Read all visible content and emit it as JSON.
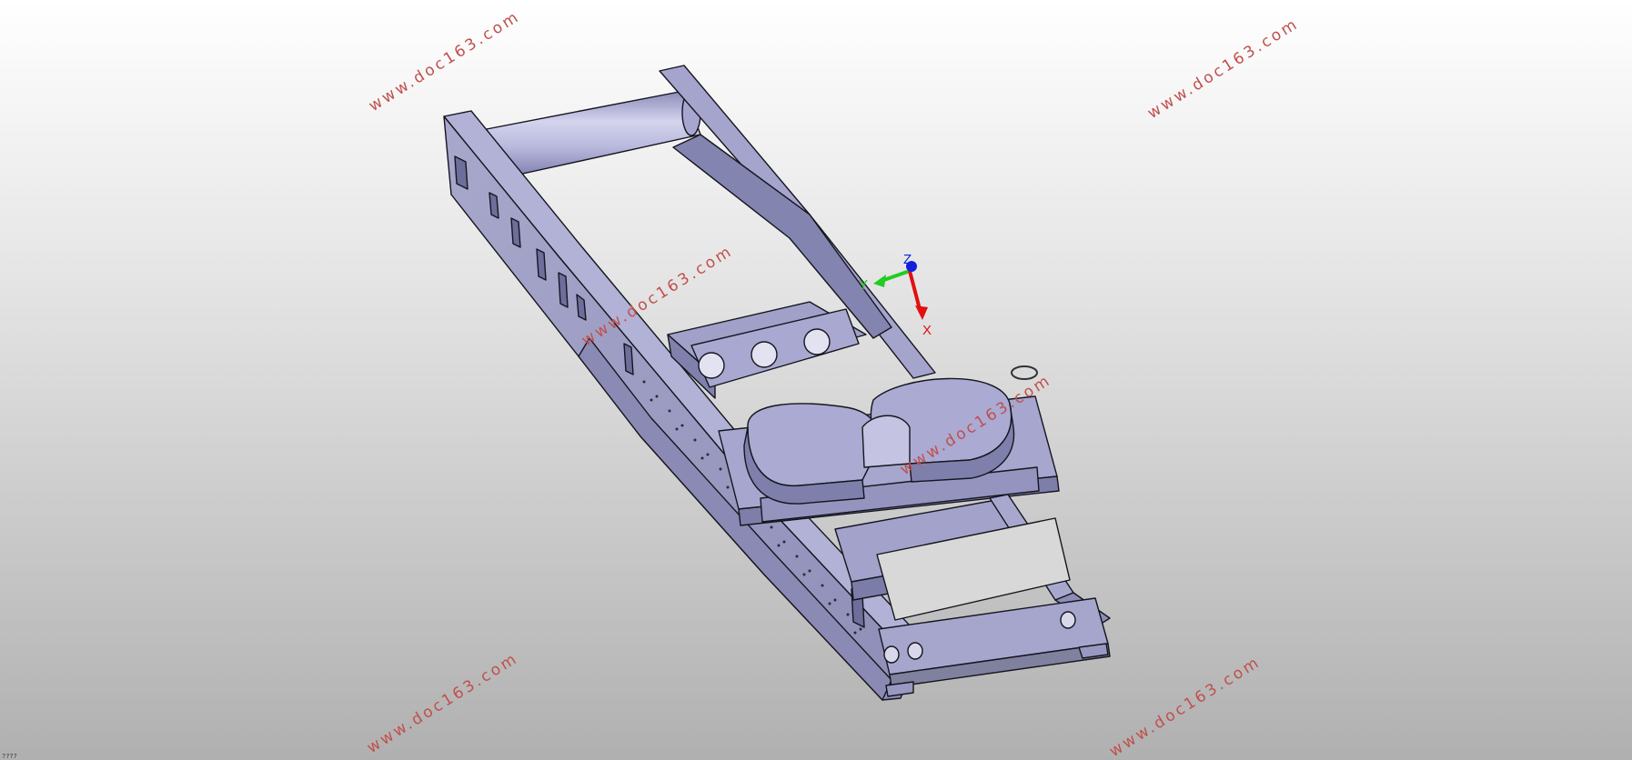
{
  "viewport": {
    "background_top": "#ffffff",
    "background_bottom": "#b0b0b0",
    "model_color": "#9c9cc4",
    "model_edge_color": "#15151f"
  },
  "triad": {
    "x_label": "X",
    "y_label": "Y",
    "z_label": "Z",
    "x_color": "#e01010",
    "y_color": "#22cc22",
    "z_color": "#1020dd"
  },
  "watermarks": {
    "text": "www.doc163.com",
    "color": "#c0504d"
  },
  "status": {
    "text": "????"
  }
}
